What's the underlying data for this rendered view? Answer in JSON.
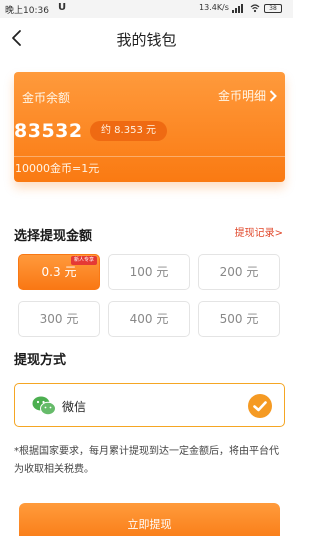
{
  "status_bar": {
    "time": "晚上10:36",
    "app_badge": "U",
    "network_speed": "13.4K/s",
    "battery": "38"
  },
  "header": {
    "back_icon": "chevron-left-icon",
    "title": "我的钱包"
  },
  "balance": {
    "label": "金币余额",
    "detail_link": "金币明细",
    "coins": "83532",
    "approx_yuan": "约 8.353 元",
    "exchange_rate": "10000金币=1元",
    "accent": "#fa7a12"
  },
  "withdraw_amount": {
    "title": "选择提现金额",
    "history_link": "提现记录>",
    "options": [
      {
        "label": "0.3 元",
        "selected": true,
        "badge": "新人专享"
      },
      {
        "label": "100 元",
        "selected": false,
        "badge": ""
      },
      {
        "label": "200 元",
        "selected": false,
        "badge": ""
      },
      {
        "label": "300 元",
        "selected": false,
        "badge": ""
      },
      {
        "label": "400 元",
        "selected": false,
        "badge": ""
      },
      {
        "label": "500 元",
        "selected": false,
        "badge": ""
      }
    ]
  },
  "withdraw_method": {
    "title": "提现方式",
    "selected_method": "微信",
    "icon": "wechat-icon",
    "selected_color": "#f5a623"
  },
  "notice": "*根据国家要求，每月累计提现到达一定金额后，将由平台代 为收取相关税费。",
  "submit_button": "立即提现"
}
